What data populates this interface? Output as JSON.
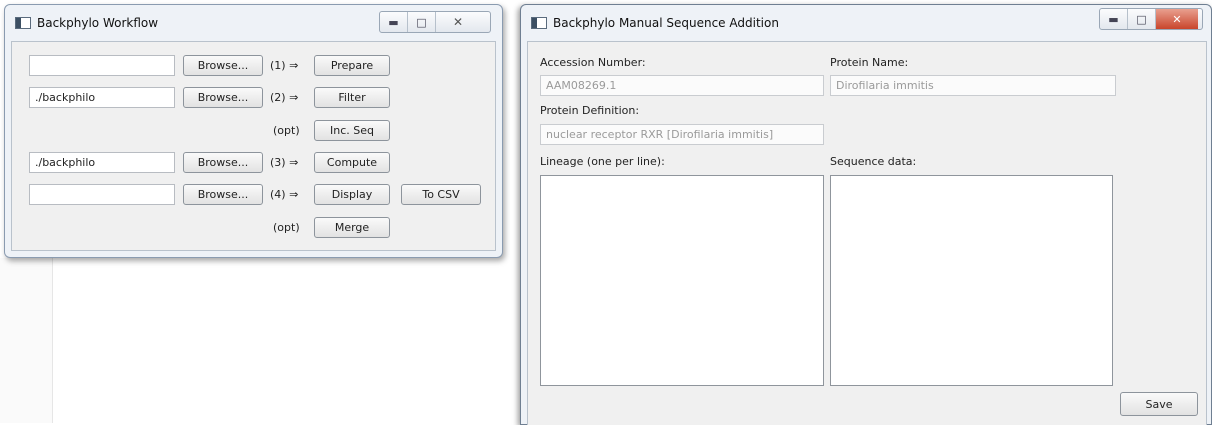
{
  "workflow": {
    "title": "Backphylo Workflow",
    "rows": [
      {
        "input": "",
        "browse": "Browse...",
        "step": "(1) ⇒",
        "action": "Prepare"
      },
      {
        "input": "./backphilo",
        "browse": "Browse...",
        "step": "(2) ⇒",
        "action": "Filter"
      },
      {
        "step": "(opt)",
        "action": "Inc. Seq"
      },
      {
        "input": "./backphilo",
        "browse": "Browse...",
        "step": "(3) ⇒",
        "action": "Compute"
      },
      {
        "input": "",
        "browse": "Browse...",
        "step": "(4) ⇒",
        "action": "Display",
        "extra": "To CSV"
      },
      {
        "step": "(opt)",
        "action": "Merge"
      }
    ]
  },
  "manual": {
    "title": "Backphylo Manual Sequence Addition",
    "accession_label": "Accession Number:",
    "accession_value": "AAM08269.1",
    "protein_name_label": "Protein Name:",
    "protein_name_value": "Dirofilaria immitis",
    "definition_label": "Protein Definition:",
    "definition_value": "nuclear receptor RXR [Dirofilaria immitis]",
    "lineage_label": "Lineage (one per line):",
    "sequence_label": "Sequence data:",
    "save_label": "Save"
  },
  "icons": {
    "minimize": "minimize-icon",
    "maximize": "maximize-icon",
    "close": "close-icon",
    "app": "app-icon"
  },
  "colors": {
    "close_button": "#c9452c",
    "window_frame": "#eef2f7"
  }
}
